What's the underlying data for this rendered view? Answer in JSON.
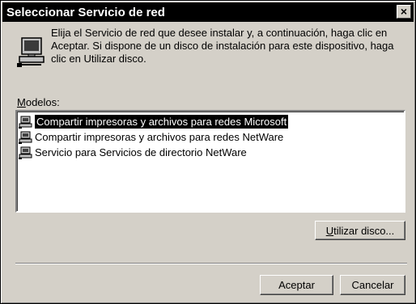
{
  "window": {
    "title": "Seleccionar Servicio de red",
    "close_glyph": "×"
  },
  "intro": {
    "icon": "network-computer-icon",
    "text": "Elija el Servicio de red que desee instalar y, a continuación, haga clic en Aceptar. Si dispone de un disco de instalación para este dispositivo, haga clic en Utilizar disco."
  },
  "models": {
    "label_accel": "M",
    "label_rest": "odelos:",
    "items": [
      {
        "label": "Compartir impresoras y archivos para redes Microsoft",
        "selected": true,
        "icon": "network-service-icon"
      },
      {
        "label": "Compartir impresoras y archivos para redes NetWare",
        "selected": false,
        "icon": "network-service-icon"
      },
      {
        "label": "Servicio para Servicios de directorio NetWare",
        "selected": false,
        "icon": "network-service-icon"
      }
    ]
  },
  "buttons": {
    "have_disk_accel": "U",
    "have_disk_rest": "tilizar disco...",
    "ok": "Aceptar",
    "cancel": "Cancelar"
  },
  "colors": {
    "face": "#d4d0c8",
    "titlebar": "#000000",
    "selection": "#000000"
  }
}
